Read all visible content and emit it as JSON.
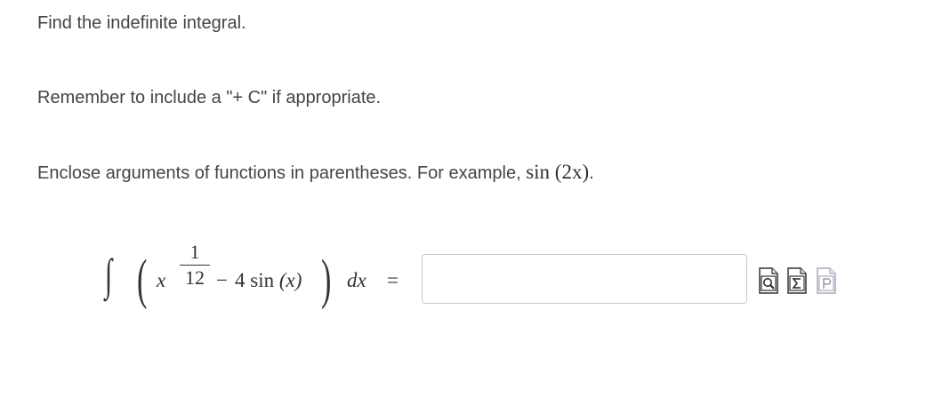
{
  "instructions": {
    "line1": "Find the indefinite integral.",
    "line2": "Remember to include a \"+ C\" if appropriate.",
    "line3_text": "Enclose arguments of functions in parentheses. For example, ",
    "line3_example_fn": "sin",
    "line3_example_arg": "(2x)",
    "line3_end": "."
  },
  "problem": {
    "integral_sign": "∫",
    "left_paren": "(",
    "variable": "x",
    "exponent_numerator": "1",
    "exponent_denominator": "12",
    "minus": "−",
    "term": "4 sin",
    "term_arg": "(x)",
    "right_paren": ")",
    "differential": "dx",
    "equals": "="
  },
  "answer": {
    "value": "",
    "placeholder": ""
  },
  "tools": [
    {
      "icon": "preview-icon"
    },
    {
      "icon": "sigma-icon"
    },
    {
      "icon": "p-icon"
    }
  ]
}
